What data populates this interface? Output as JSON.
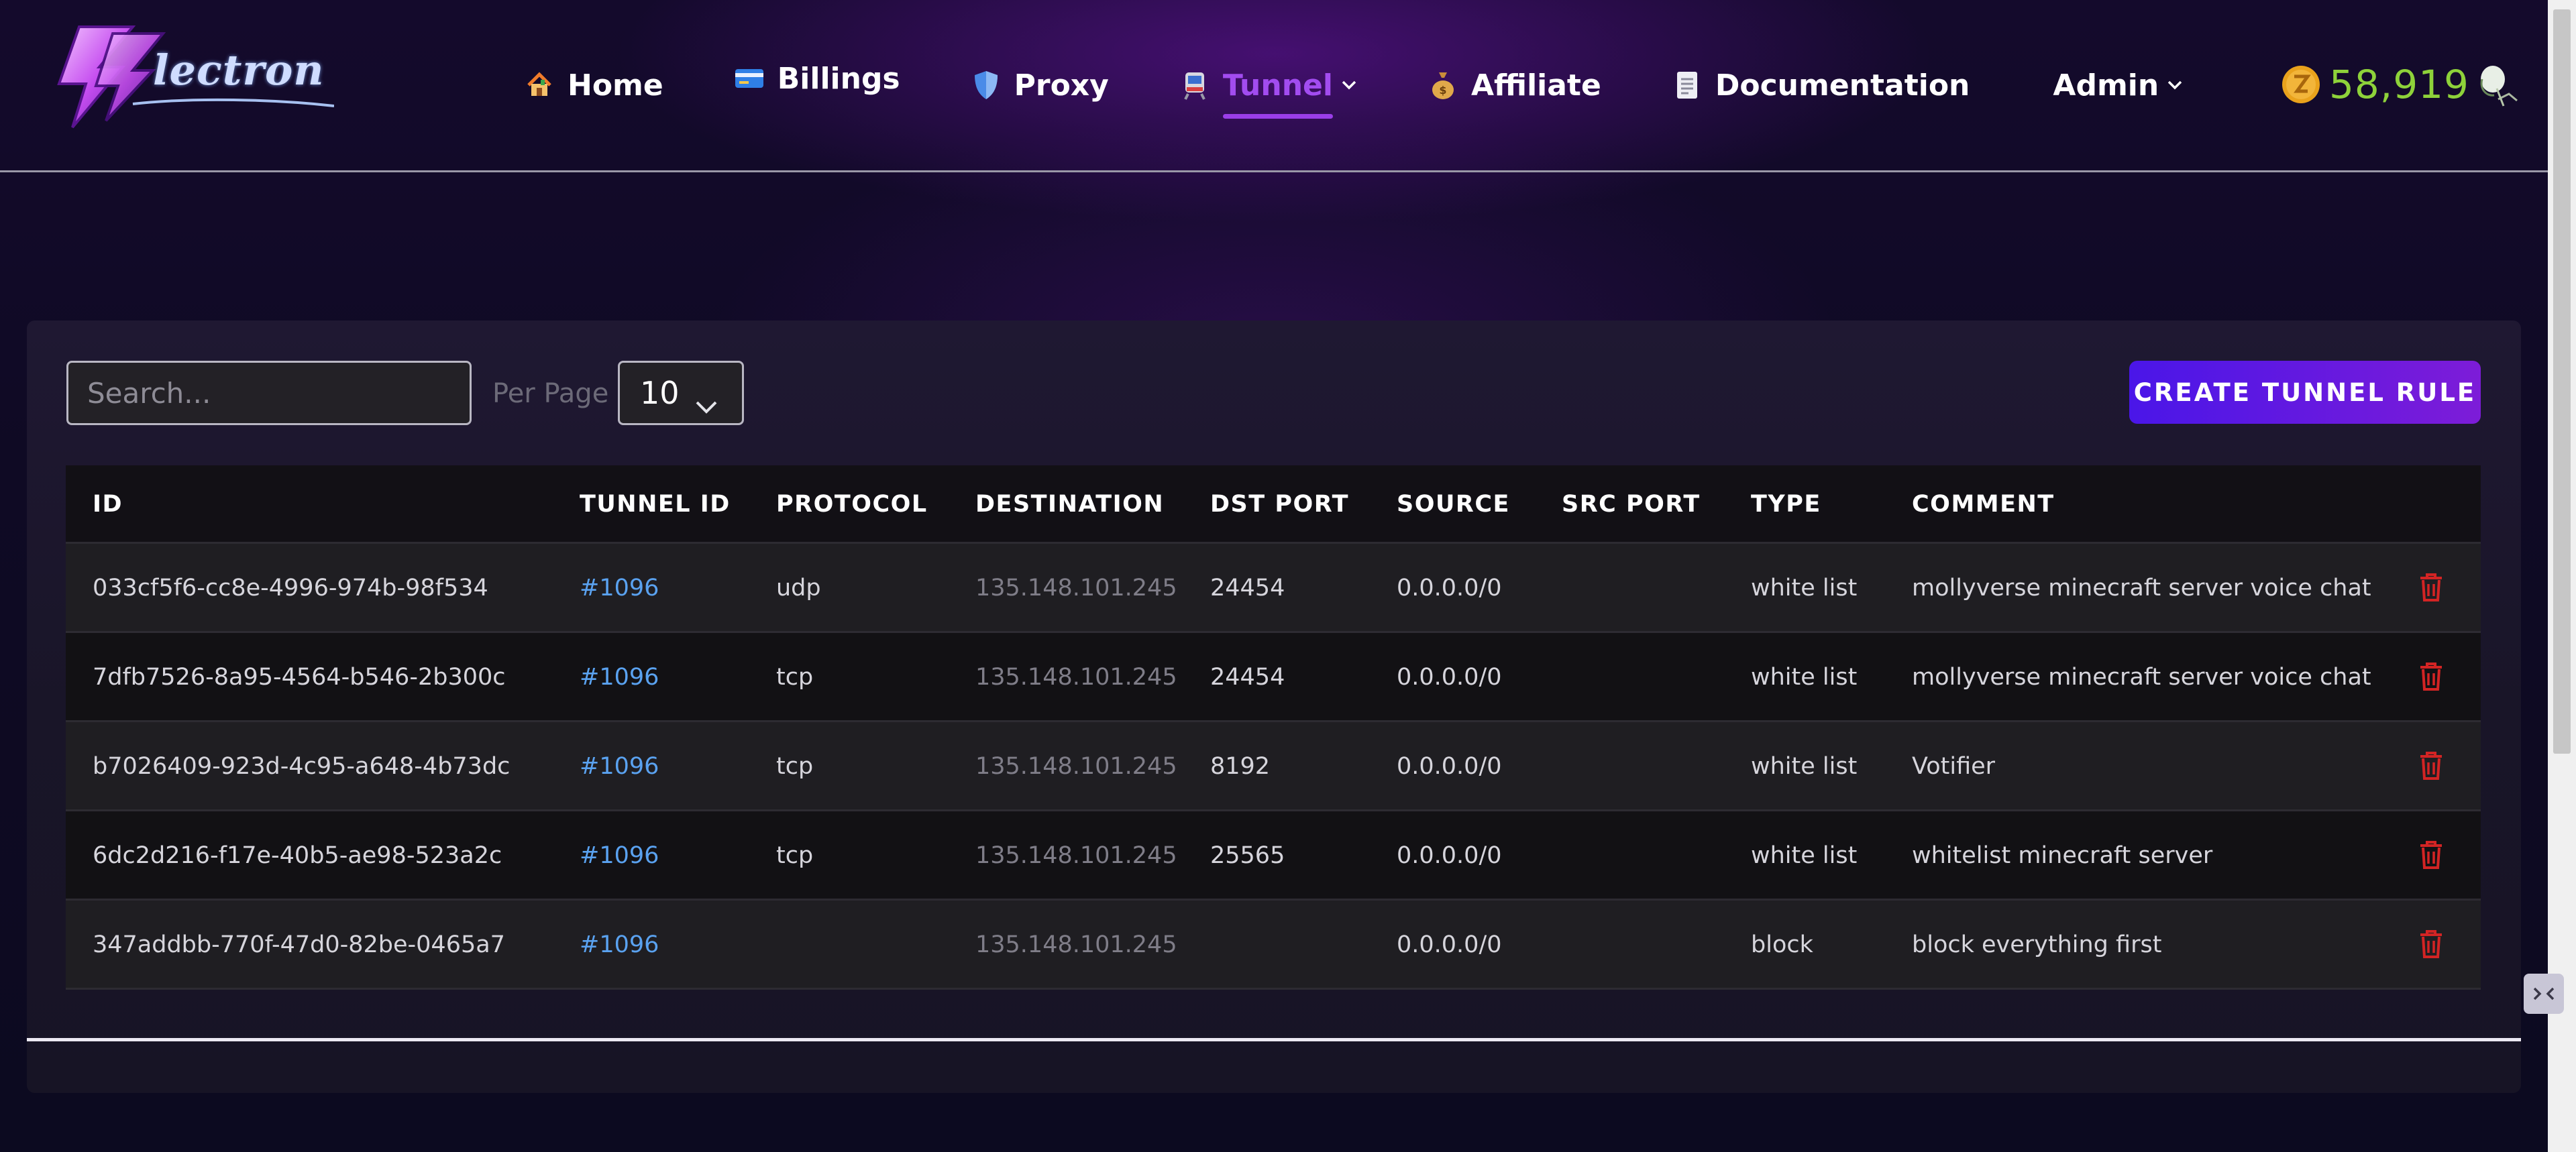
{
  "header": {
    "logo_text": "lectron",
    "nav": [
      {
        "label": "Home",
        "icon": "house-icon"
      },
      {
        "label": "Billings",
        "icon": "credit-card-icon"
      },
      {
        "label": "Proxy",
        "icon": "shield-icon"
      },
      {
        "label": "Tunnel",
        "icon": "train-icon",
        "active": true
      },
      {
        "label": "Affiliate",
        "icon": "money-bag-icon"
      },
      {
        "label": "Documentation",
        "icon": "document-icon"
      },
      {
        "label": "Admin"
      }
    ],
    "coins": "58,919",
    "coin_color": "#8ed23a",
    "accent_color": "#a24cf0"
  },
  "controls": {
    "search_placeholder": "Search...",
    "per_page_label": "Per Page",
    "per_page_value": "10",
    "create_label": "CREATE TUNNEL RULE"
  },
  "table": {
    "columns": [
      "ID",
      "TUNNEL ID",
      "PROTOCOL",
      "DESTINATION",
      "DST PORT",
      "SOURCE",
      "SRC PORT",
      "TYPE",
      "COMMENT"
    ],
    "rows": [
      {
        "id": "033cf5f6-cc8e-4996-974b-98f534",
        "tunnel_id": "#1096",
        "protocol": "udp",
        "destination": "135.148.101.245",
        "dst_port": "24454",
        "source": "0.0.0.0/0",
        "src_port": "",
        "type": "white list",
        "comment": "mollyverse minecraft server voice chat"
      },
      {
        "id": "7dfb7526-8a95-4564-b546-2b300c",
        "tunnel_id": "#1096",
        "protocol": "tcp",
        "destination": "135.148.101.245",
        "dst_port": "24454",
        "source": "0.0.0.0/0",
        "src_port": "",
        "type": "white list",
        "comment": "mollyverse minecraft server voice chat"
      },
      {
        "id": "b7026409-923d-4c95-a648-4b73dc",
        "tunnel_id": "#1096",
        "protocol": "tcp",
        "destination": "135.148.101.245",
        "dst_port": "8192",
        "source": "0.0.0.0/0",
        "src_port": "",
        "type": "white list",
        "comment": "Votifier"
      },
      {
        "id": "6dc2d216-f17e-40b5-ae98-523a2c",
        "tunnel_id": "#1096",
        "protocol": "tcp",
        "destination": "135.148.101.245",
        "dst_port": "25565",
        "source": "0.0.0.0/0",
        "src_port": "",
        "type": "white list",
        "comment": "whitelist minecraft server"
      },
      {
        "id": "347addbb-770f-47d0-82be-0465a7",
        "tunnel_id": "#1096",
        "protocol": "",
        "destination": "135.148.101.245",
        "dst_port": "",
        "source": "0.0.0.0/0",
        "src_port": "",
        "type": "block",
        "comment": "block everything first"
      }
    ]
  }
}
